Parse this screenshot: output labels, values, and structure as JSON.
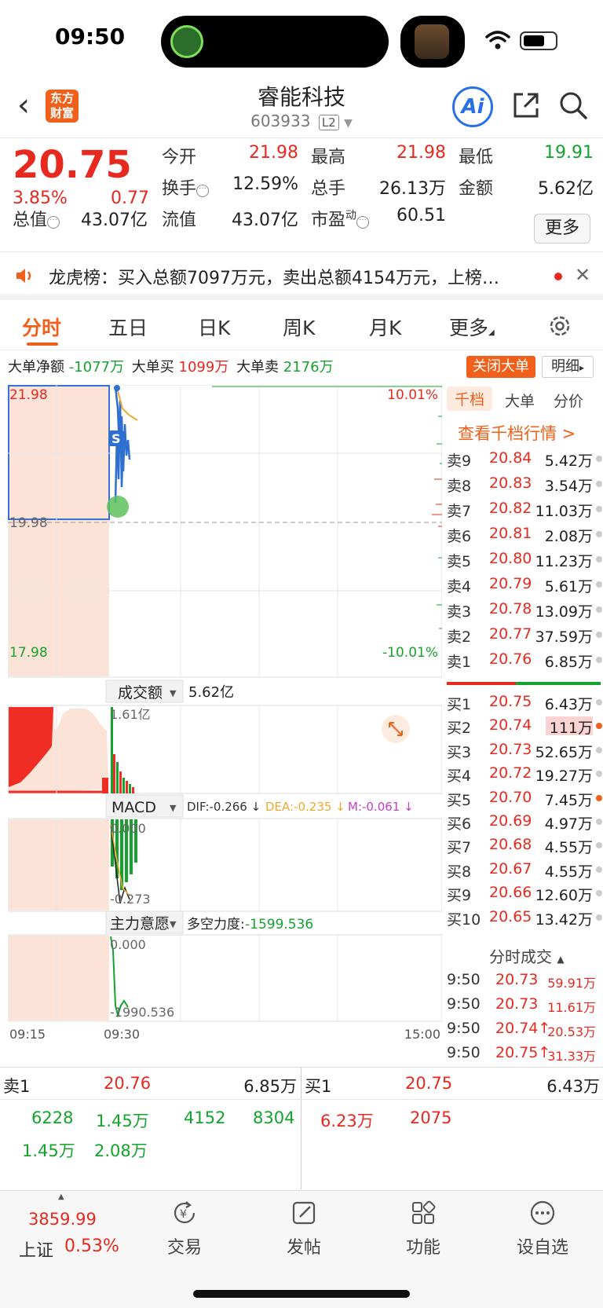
{
  "status": {
    "time": "09:50"
  },
  "header": {
    "stock_name": "睿能科技",
    "stock_code": "603933",
    "level_badge": "L2",
    "ai_label": "Ai",
    "logo_text": "东方财富"
  },
  "quote": {
    "price": "20.75",
    "change_pct": "3.85%",
    "change": "0.77",
    "open_label": "今开",
    "open": "21.98",
    "high_label": "最高",
    "high": "21.98",
    "low_label": "最低",
    "low": "19.91",
    "turnover_label": "换手",
    "turnover": "12.59%",
    "volume_label": "总手",
    "volume": "26.13万",
    "amount_label": "金额",
    "amount": "5.62亿",
    "mktcap_label": "总值",
    "mktcap": "43.07亿",
    "float_label": "流值",
    "float": "43.07亿",
    "pe_label": "市盈",
    "pe_sup": "动",
    "pe": "60.51",
    "more_label": "更多"
  },
  "notice": {
    "text": "龙虎榜：买入总额7097万元，卖出总额4154万元，上榜…"
  },
  "tabs": [
    "分时",
    "五日",
    "日K",
    "周K",
    "月K",
    "更多"
  ],
  "big_order": {
    "net_label": "大单净额",
    "net": "-1077万",
    "buy_label": "大单买",
    "buy": "1099万",
    "sell_label": "大单卖",
    "sell": "2176万",
    "close_label": "关闭大单",
    "detail_label": "明细"
  },
  "chart": {
    "y_top": "21.98",
    "y_mid": "19.98",
    "y_bottom": "17.98",
    "pct_top": "10.01%",
    "pct_bottom": "-10.01%",
    "turnover_indicator": "成交额",
    "turnover_value": "5.62亿",
    "turnover_axis": "1.61亿",
    "macd_indicator": "MACD",
    "dif": "DIF:-0.266 ↓",
    "dea": "DEA:-0.235 ↓",
    "m": "M:-0.061 ↓",
    "macd_top": "0.000",
    "macd_bottom": "-0.273",
    "force_indicator": "主力意愿",
    "force_label": "多空力度:",
    "force_value": "-1599.536",
    "force_top": "0.000",
    "force_bottom": "-1990.536",
    "time_start": "09:15",
    "time_open": "09:30",
    "time_end": "15:00",
    "marker": "S"
  },
  "right_panel": {
    "tabs": [
      "千档",
      "大单",
      "分价"
    ],
    "view_depth": "查看千档行情 >",
    "asks": [
      {
        "label": "卖9",
        "price": "20.84",
        "vol": "5.42万"
      },
      {
        "label": "卖8",
        "price": "20.83",
        "vol": "3.54万"
      },
      {
        "label": "卖7",
        "price": "20.82",
        "vol": "11.03万"
      },
      {
        "label": "卖6",
        "price": "20.81",
        "vol": "2.08万"
      },
      {
        "label": "卖5",
        "price": "20.80",
        "vol": "11.23万"
      },
      {
        "label": "卖4",
        "price": "20.79",
        "vol": "5.61万"
      },
      {
        "label": "卖3",
        "price": "20.78",
        "vol": "13.09万"
      },
      {
        "label": "卖2",
        "price": "20.77",
        "vol": "37.59万"
      },
      {
        "label": "卖1",
        "price": "20.76",
        "vol": "6.85万"
      }
    ],
    "bids": [
      {
        "label": "买1",
        "price": "20.75",
        "vol": "6.43万"
      },
      {
        "label": "买2",
        "price": "20.74",
        "vol": "111万"
      },
      {
        "label": "买3",
        "price": "20.73",
        "vol": "52.65万"
      },
      {
        "label": "买4",
        "price": "20.72",
        "vol": "19.27万"
      },
      {
        "label": "买5",
        "price": "20.70",
        "vol": "7.45万"
      },
      {
        "label": "买6",
        "price": "20.69",
        "vol": "4.97万"
      },
      {
        "label": "买7",
        "price": "20.68",
        "vol": "4.55万"
      },
      {
        "label": "买8",
        "price": "20.67",
        "vol": "4.55万"
      },
      {
        "label": "买9",
        "price": "20.66",
        "vol": "12.60万"
      },
      {
        "label": "买10",
        "price": "20.65",
        "vol": "13.42万"
      }
    ],
    "ticks_title": "分时成交",
    "ticks": [
      {
        "time": "9:50",
        "price": "20.73",
        "vol": "59.91万"
      },
      {
        "time": "9:50",
        "price": "20.73",
        "vol": "11.61万"
      },
      {
        "time": "9:50",
        "price": "20.74↑",
        "vol": "20.53万"
      },
      {
        "time": "9:50",
        "price": "20.75↑",
        "vol": "31.33万"
      }
    ]
  },
  "depth": {
    "sell_label": "卖1",
    "sell_price": "20.76",
    "sell_vol": "6.85万",
    "buy_label": "买1",
    "buy_price": "20.75",
    "buy_vol": "6.43万",
    "sell_queue": [
      "6228",
      "1.45万",
      "4152",
      "8304",
      "1.45万",
      "2.08万"
    ],
    "buy_queue": [
      "6.23万",
      "2075"
    ]
  },
  "nav": {
    "index_value": "3859.99",
    "index_name": "上证",
    "index_pct": "0.53%",
    "items": [
      "交易",
      "发帖",
      "功能",
      "设自选"
    ]
  }
}
